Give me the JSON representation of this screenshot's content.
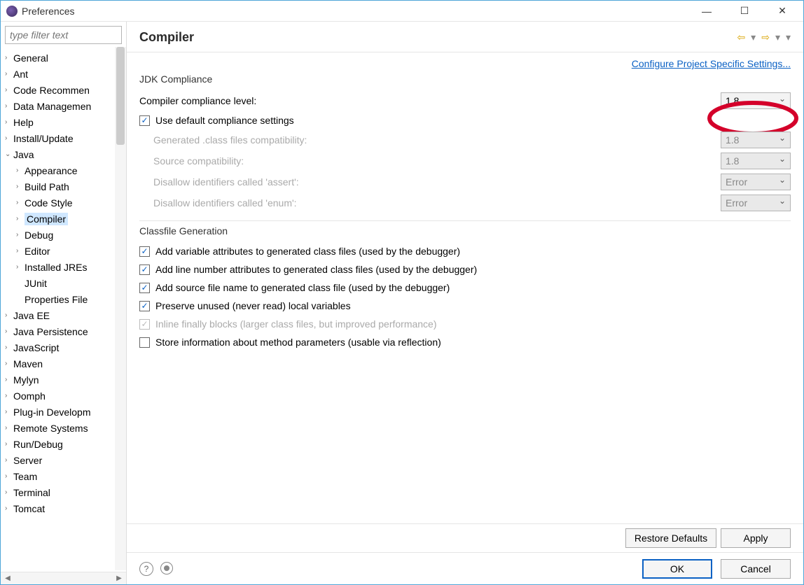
{
  "window": {
    "title": "Preferences"
  },
  "filter": {
    "placeholder": "type filter text"
  },
  "tree": [
    {
      "label": "General",
      "level": 0,
      "expand": ">"
    },
    {
      "label": "Ant",
      "level": 0,
      "expand": ">"
    },
    {
      "label": "Code Recommen",
      "level": 0,
      "expand": ">"
    },
    {
      "label": "Data Managemen",
      "level": 0,
      "expand": ">"
    },
    {
      "label": "Help",
      "level": 0,
      "expand": ">"
    },
    {
      "label": "Install/Update",
      "level": 0,
      "expand": ">"
    },
    {
      "label": "Java",
      "level": 0,
      "expand": "v"
    },
    {
      "label": "Appearance",
      "level": 1,
      "expand": ">"
    },
    {
      "label": "Build Path",
      "level": 1,
      "expand": ">"
    },
    {
      "label": "Code Style",
      "level": 1,
      "expand": ">"
    },
    {
      "label": "Compiler",
      "level": 1,
      "expand": ">",
      "selected": true
    },
    {
      "label": "Debug",
      "level": 1,
      "expand": ">"
    },
    {
      "label": "Editor",
      "level": 1,
      "expand": ">"
    },
    {
      "label": "Installed JREs",
      "level": 1,
      "expand": ">"
    },
    {
      "label": "JUnit",
      "level": 1,
      "expand": ""
    },
    {
      "label": "Properties File",
      "level": 1,
      "expand": ""
    },
    {
      "label": "Java EE",
      "level": 0,
      "expand": ">"
    },
    {
      "label": "Java Persistence",
      "level": 0,
      "expand": ">"
    },
    {
      "label": "JavaScript",
      "level": 0,
      "expand": ">"
    },
    {
      "label": "Maven",
      "level": 0,
      "expand": ">"
    },
    {
      "label": "Mylyn",
      "level": 0,
      "expand": ">"
    },
    {
      "label": "Oomph",
      "level": 0,
      "expand": ">"
    },
    {
      "label": "Plug-in Developm",
      "level": 0,
      "expand": ">"
    },
    {
      "label": "Remote Systems",
      "level": 0,
      "expand": ">"
    },
    {
      "label": "Run/Debug",
      "level": 0,
      "expand": ">"
    },
    {
      "label": "Server",
      "level": 0,
      "expand": ">"
    },
    {
      "label": "Team",
      "level": 0,
      "expand": ">"
    },
    {
      "label": "Terminal",
      "level": 0,
      "expand": ">"
    },
    {
      "label": "Tomcat",
      "level": 0,
      "expand": ">"
    }
  ],
  "header": {
    "title": "Compiler"
  },
  "link": {
    "configure": "Configure Project Specific Settings..."
  },
  "jdk": {
    "group": "JDK Compliance",
    "compliance_label": "Compiler compliance level:",
    "compliance_value": "1.8",
    "use_default": "Use default compliance settings",
    "gen_class": "Generated .class files compatibility:",
    "gen_class_value": "1.8",
    "src_compat": "Source compatibility:",
    "src_compat_value": "1.8",
    "disallow_assert": "Disallow identifiers called 'assert':",
    "disallow_assert_value": "Error",
    "disallow_enum": "Disallow identifiers called 'enum':",
    "disallow_enum_value": "Error"
  },
  "classfile": {
    "group": "Classfile Generation",
    "c1": "Add variable attributes to generated class files (used by the debugger)",
    "c2": "Add line number attributes to generated class files (used by the debugger)",
    "c3": "Add source file name to generated class file (used by the debugger)",
    "c4": "Preserve unused (never read) local variables",
    "c5": "Inline finally blocks (larger class files, but improved performance)",
    "c6": "Store information about method parameters (usable via reflection)"
  },
  "buttons": {
    "restore": "Restore Defaults",
    "apply": "Apply",
    "ok": "OK",
    "cancel": "Cancel"
  }
}
